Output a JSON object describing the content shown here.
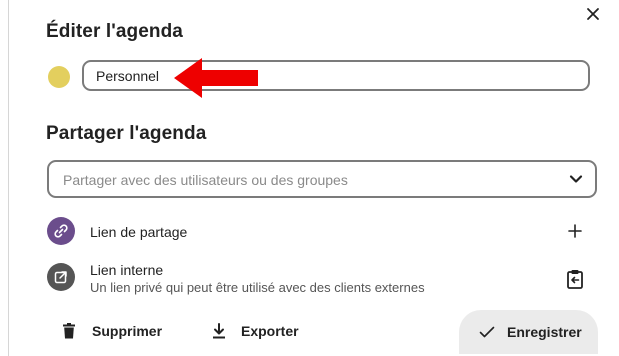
{
  "dialog": {
    "title_edit": "Éditer l'agenda",
    "calendar_name": "Personnel",
    "calendar_color": "#e3cf5e",
    "title_share": "Partager l'agenda",
    "share_placeholder": "Partager avec des utilisateurs ou des groupes"
  },
  "share_links": {
    "public_link_label": "Lien de partage",
    "internal_link_label": "Lien interne",
    "internal_link_description": "Un lien privé qui peut être utilisé avec des clients externes"
  },
  "actions": {
    "delete_label": "Supprimer",
    "export_label": "Exporter",
    "save_label": "Enregistrer"
  },
  "colors": {
    "accent_purple": "#6b4d8c",
    "annotation_arrow": "#ee0000"
  },
  "icons": [
    "close-icon",
    "link-icon",
    "external-link-icon",
    "plus-icon",
    "clipboard-icon",
    "trash-icon",
    "download-icon",
    "check-icon",
    "chevron-down-icon"
  ]
}
